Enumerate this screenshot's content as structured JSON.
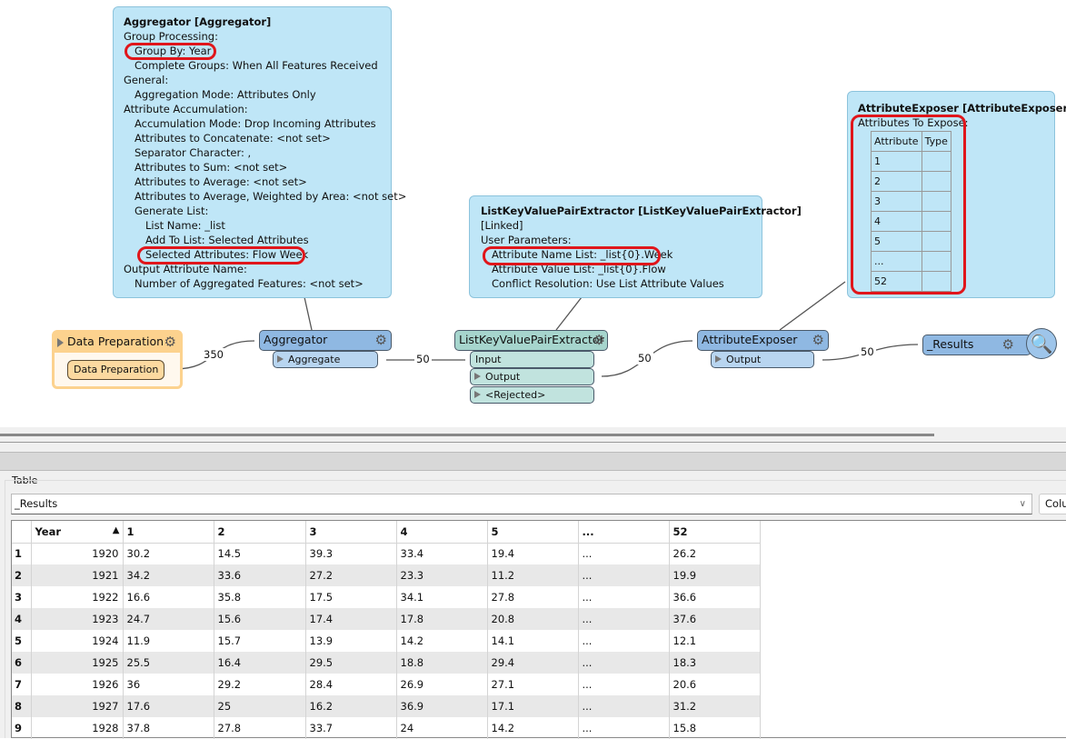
{
  "aggregator_tip": {
    "title": "Aggregator [Aggregator]",
    "lines": [
      {
        "t": "Group Processing:",
        "i": 0
      },
      {
        "t": "Group By: Year",
        "i": 1
      },
      {
        "t": "Complete Groups: When All Features Received",
        "i": 1
      },
      {
        "t": "General:",
        "i": 0
      },
      {
        "t": "Aggregation Mode: Attributes Only",
        "i": 1
      },
      {
        "t": "Attribute Accumulation:",
        "i": 0
      },
      {
        "t": "Accumulation Mode: Drop Incoming Attributes",
        "i": 1
      },
      {
        "t": "Attributes to Concatenate: <not set>",
        "i": 1
      },
      {
        "t": "Separator Character: ,",
        "i": 1
      },
      {
        "t": "Attributes to Sum: <not set>",
        "i": 1
      },
      {
        "t": "Attributes to Average: <not set>",
        "i": 1
      },
      {
        "t": "Attributes to Average, Weighted by Area: <not set>",
        "i": 1
      },
      {
        "t": "Generate List:",
        "i": 1
      },
      {
        "t": "List Name: _list",
        "i": 2
      },
      {
        "t": "Add To List: Selected Attributes",
        "i": 2
      },
      {
        "t": "Selected Attributes: Flow Week",
        "i": 2
      },
      {
        "t": "Output Attribute Name:",
        "i": 0
      },
      {
        "t": "Number of Aggregated Features: <not set>",
        "i": 1
      }
    ]
  },
  "lkvpe_tip": {
    "title": "ListKeyValuePairExtractor [ListKeyValuePairExtractor]",
    "lines": [
      {
        "t": "[Linked]",
        "i": 0
      },
      {
        "t": "User Parameters:",
        "i": 0
      },
      {
        "t": "Attribute Name List: _list{0}.Week",
        "i": 1
      },
      {
        "t": "Attribute Value List: _list{0}.Flow",
        "i": 1
      },
      {
        "t": "Conflict Resolution: Use List Attribute Values",
        "i": 1
      }
    ]
  },
  "exposer_tip": {
    "title": "AttributeExposer [AttributeExposer]",
    "subtitle": "Attributes To Expose:",
    "headers": [
      "Attribute",
      "Type"
    ],
    "rows": [
      "1",
      "2",
      "3",
      "4",
      "5",
      "...",
      "52"
    ]
  },
  "nodes": {
    "bookmark": "Data Preparation",
    "dataprep": "Data Preparation",
    "aggregator": "Aggregator",
    "aggregate_port": "Aggregate",
    "lkvpe": "ListKeyValuePairExtractor",
    "input_port": "Input",
    "output_port": "Output",
    "rejected_port": "<Rejected>",
    "exposer": "AttributeExposer",
    "exposer_output": "Output",
    "results": "_Results"
  },
  "counts": {
    "c1": "350",
    "c2": "50",
    "c3": "50",
    "c4": "50"
  },
  "panel": {
    "group_label": "Table",
    "dataset": "_Results",
    "columns_button": "Colu"
  },
  "table": {
    "headers": [
      "Year",
      "1",
      "2",
      "3",
      "4",
      "5",
      "...",
      "52"
    ],
    "sort": "ascending on Year",
    "rows": [
      [
        "1",
        "1920",
        "30.2",
        "14.5",
        "39.3",
        "33.4",
        "19.4",
        "...",
        "26.2"
      ],
      [
        "2",
        "1921",
        "34.2",
        "33.6",
        "27.2",
        "23.3",
        "11.2",
        "...",
        "19.9"
      ],
      [
        "3",
        "1922",
        "16.6",
        "35.8",
        "17.5",
        "34.1",
        "27.8",
        "...",
        "36.6"
      ],
      [
        "4",
        "1923",
        "24.7",
        "15.6",
        "17.4",
        "17.8",
        "20.8",
        "...",
        "37.6"
      ],
      [
        "5",
        "1924",
        "11.9",
        "15.7",
        "13.9",
        "14.2",
        "14.1",
        "...",
        "12.1"
      ],
      [
        "6",
        "1925",
        "25.5",
        "16.4",
        "29.5",
        "18.8",
        "29.4",
        "...",
        "18.3"
      ],
      [
        "7",
        "1926",
        "36",
        "29.2",
        "28.4",
        "26.9",
        "27.1",
        "...",
        "20.6"
      ],
      [
        "8",
        "1927",
        "17.6",
        "25",
        "16.2",
        "36.9",
        "17.1",
        "...",
        "31.2"
      ],
      [
        "9",
        "1928",
        "37.8",
        "27.8",
        "33.7",
        "24",
        "14.2",
        "...",
        "15.8"
      ]
    ]
  }
}
